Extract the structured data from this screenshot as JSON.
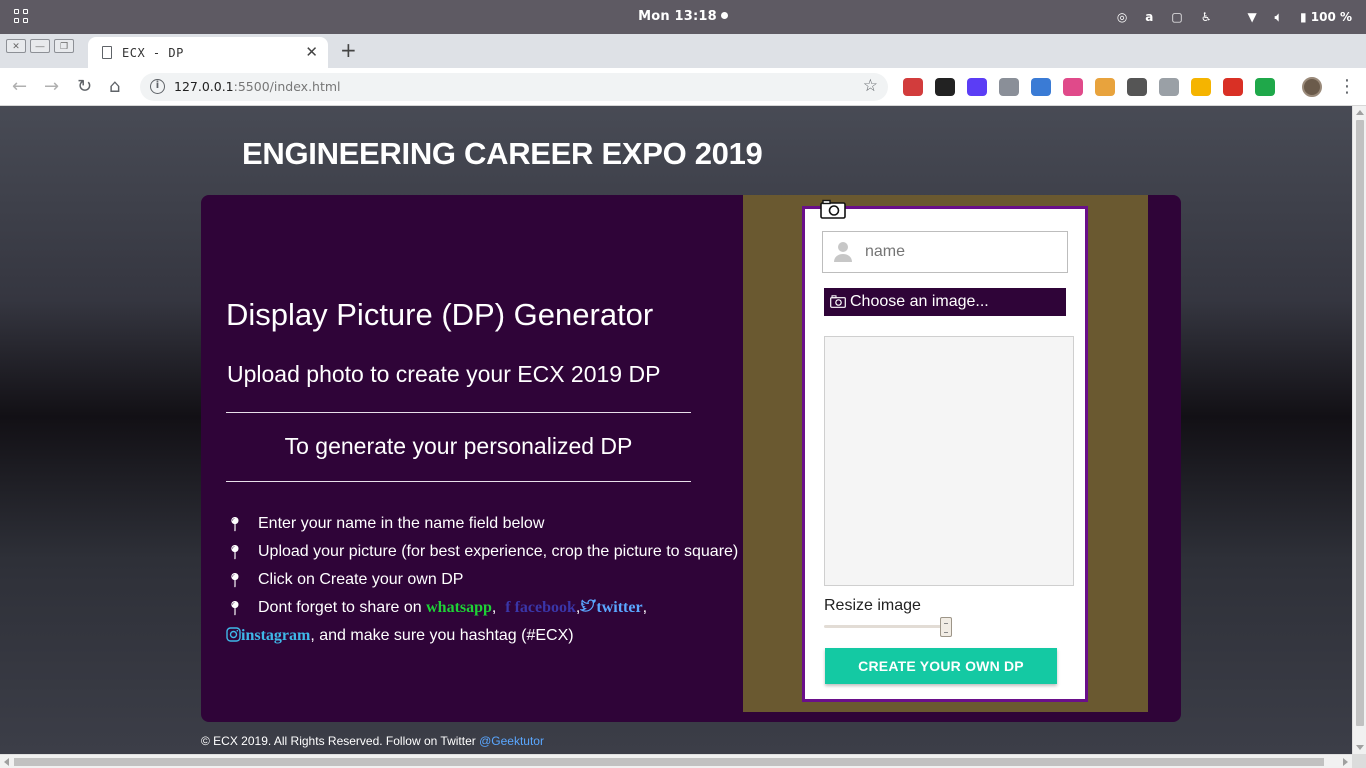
{
  "os": {
    "clock": "Mon 13:18",
    "battery": "100 %",
    "tray_icons": [
      "record-icon",
      "a-icon",
      "clipboard-icon",
      "accessibility-icon",
      "wifi-icon",
      "volume-icon",
      "battery-icon"
    ]
  },
  "browser": {
    "tab_title": "ECX  -  DP",
    "url_host": "127.0.0.1",
    "url_rest": ":5500/index.html",
    "extension_colors": [
      "#d23c3c",
      "#222222",
      "#5b3df5",
      "#8a8f98",
      "#3a7bd5",
      "#e04a8a",
      "#e8a33d",
      "#555555",
      "#9aa0a6",
      "#f5b400",
      "#d93025",
      "#1fa84a"
    ]
  },
  "page": {
    "title": "ENGINEERING CAREER EXPO 2019",
    "heading": "Display Picture (DP) Generator",
    "subheading": "Upload photo to create your ECX 2019 DP",
    "instructions_heading": "To generate your personalized DP",
    "steps": [
      "Enter your name in the name field below",
      "Upload your picture (for best experience, crop the picture to square)",
      "Click on Create your own DP"
    ],
    "share": {
      "prefix": "Dont forget to share on ",
      "whatsapp": "whatsapp",
      "facebook": "facebook",
      "twitter": "twitter",
      "instagram": "instagram",
      "suffix": ", and make sure you hashtag (#ECX)"
    },
    "colors": {
      "panel": "#2f0438",
      "right_bg": "#6a5930",
      "card_border": "#6a0f8a",
      "create_button": "#14c9a3",
      "whatsapp": "#1ed236",
      "facebook": "#3a36a8",
      "twitter": "#5aa7ff",
      "instagram": "#3fb8e8"
    }
  },
  "form": {
    "name_placeholder": "name",
    "name_value": "",
    "choose_label": "Choose an image...",
    "resize_label": "Resize image",
    "resize_value_fraction": 0.95,
    "create_label": "CREATE YOUR OWN DP"
  },
  "footer": {
    "text": "© ECX 2019. All Rights Reserved. Follow on Twitter ",
    "link": "@Geektutor"
  }
}
